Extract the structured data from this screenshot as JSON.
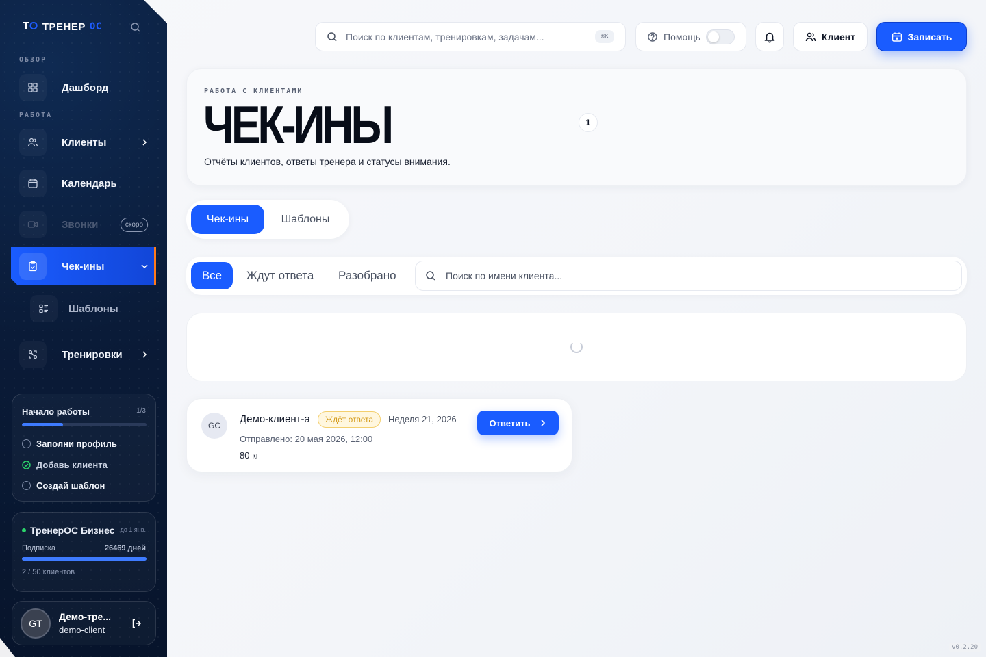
{
  "sidebar": {
    "logo_mark": "Т",
    "logo_mark_accent": "О",
    "logo_text": "ТРЕНЕР",
    "logo_accent": "ОС",
    "sections": {
      "overview": "ОБЗОР",
      "work": "РАБОТА"
    },
    "items": {
      "dashboard": "Дашборд",
      "clients": "Клиенты",
      "calendar": "Календарь",
      "calls": "Звонки",
      "calls_badge": "скоро",
      "checkins": "Чек-ины",
      "templates": "Шаблоны",
      "workouts": "Тренировки"
    },
    "onboarding": {
      "title": "Начало работы",
      "count": "1/3",
      "progress_fraction": 0.33,
      "tasks": [
        "Заполни профиль",
        "Добавь клиента",
        "Создай шаблон"
      ]
    },
    "plan": {
      "name": "ТренерОС Бизнес",
      "until": "до 1 янв.",
      "sub_label": "Подписка",
      "days": "26469 дней",
      "progress_fraction": 1.0,
      "clients": "2 / 50 клиентов"
    },
    "user": {
      "initials": "GT",
      "name": "Демо-тре...",
      "login": "demo-client"
    }
  },
  "topbar": {
    "search_placeholder": "Поиск по клиентам, тренировкам, задачам...",
    "shortcut": "⌘K",
    "help": "Помощь",
    "client_button": "Клиент",
    "book_button": "Записать"
  },
  "hero": {
    "overline": "РАБОТА С КЛИЕНТАМИ",
    "title": "ЧЕК-ИНЫ",
    "count": "1",
    "description": "Отчёты клиентов, ответы тренера и статусы внимания."
  },
  "tabs": {
    "checkins": "Чек-ины",
    "templates": "Шаблоны"
  },
  "filters": {
    "all": "Все",
    "waiting": "Ждут ответа",
    "reviewed": "Разобрано",
    "search_placeholder": "Поиск по имени клиента..."
  },
  "checkin": {
    "initials": "GC",
    "client": "Демо-клиент-а",
    "status": "Ждёт ответа",
    "week": "Неделя 21, 2026",
    "sent": "Отправлено: 20 мая 2026, 12:00",
    "weight": "80 кг",
    "reply": "Ответить"
  },
  "version": "v0.2.20",
  "colors": {
    "accent": "#1a5cff",
    "sidebar": "#0a1b38",
    "status": "#d49b1a",
    "edge": "#ff7a1a"
  }
}
